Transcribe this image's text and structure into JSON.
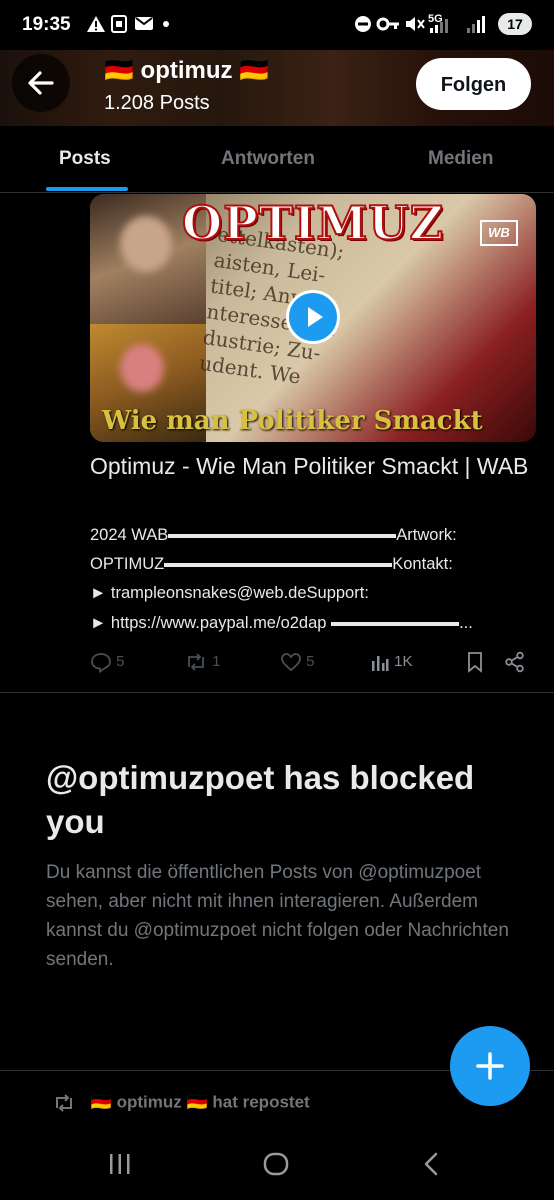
{
  "status_bar": {
    "time": "19:35",
    "battery": "17",
    "network": "5G"
  },
  "header": {
    "profile_name": "🇩🇪 optimuz 🇩🇪",
    "post_count": "1.208 Posts",
    "follow_label": "Folgen"
  },
  "tabs": [
    {
      "label": "Posts",
      "active": true
    },
    {
      "label": "Antworten",
      "active": false
    },
    {
      "label": "Medien",
      "active": false
    }
  ],
  "post": {
    "media": {
      "title": "OPTIMUZ",
      "subtitle": "Wie man Politiker Smackt",
      "logo": "WB",
      "newspaper_text": [
        "ettelkasten);",
        "aisten, Lei-",
        "titel; Anwei",
        "nteressenver",
        "dustrie; Zu-",
        "udent. We"
      ]
    },
    "title": "Optimuz - Wie Man Politiker Smackt | WAB",
    "desc": {
      "line1_a": "2024 WAB",
      "line1_b": "Artwork:",
      "line2_a": "OPTIMUZ",
      "line2_b": "Kontakt:",
      "line3": "► trampleonsnakes@web.deSupport:",
      "line4_a": "► https://www.paypal.me/o2dap",
      "line4_b": "..."
    },
    "actions": {
      "replies": "5",
      "reposts": "1",
      "likes": "5",
      "views": "1K"
    }
  },
  "blocked": {
    "title": "@optimuzpoet has blocked you",
    "text": "Du kannst die öffentlichen Posts von @optimuzpoet sehen, aber nicht mit ihnen interagieren. Außerdem kannst du @optimuzpoet nicht folgen oder Nachrichten senden."
  },
  "repost_row": {
    "label": "🇩🇪 optimuz 🇩🇪 hat repostet"
  },
  "colors": {
    "accent": "#1d9bf0",
    "background": "#000000",
    "muted": "#71767b"
  }
}
